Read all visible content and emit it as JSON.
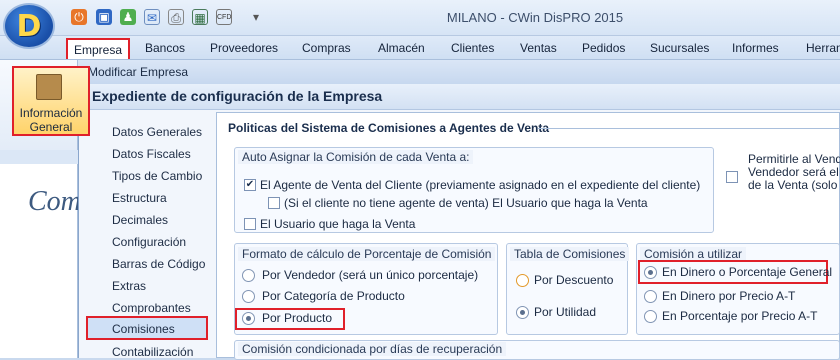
{
  "app": {
    "logo_letter": "D",
    "window_title": "MILANO - CWin DisPRO 2015",
    "quick_access_icons": [
      "power-icon",
      "save-icon",
      "users-icon",
      "mail-icon",
      "print-icon",
      "calculator-icon",
      "cfd-icon",
      "dropdown-icon"
    ]
  },
  "menu": {
    "items": [
      "Empresa",
      "Bancos",
      "Proveedores",
      "Compras",
      "Almacén",
      "Clientes",
      "Ventas",
      "Pedidos",
      "Sucursales",
      "Informes",
      "Herram"
    ]
  },
  "ribbon": {
    "info_button_label_1": "Información",
    "info_button_label_2": "General"
  },
  "left_panel": {
    "partial_text": "Com"
  },
  "modal": {
    "title": "Modificar Empresa",
    "header": "Expediente de configuración de la Empresa"
  },
  "nav": {
    "items": [
      "Datos Generales",
      "Datos Fiscales",
      "Tipos de Cambio",
      "Estructura",
      "Decimales",
      "Configuración",
      "Barras de Código",
      "Extras",
      "Comprobantes",
      "Comisiones",
      "Contabilización"
    ]
  },
  "content": {
    "section_title": "Politicas del Sistema de Comisiones a Agentes de Venta",
    "auto_assign": {
      "title": "Auto Asignar la Comisión de  cada Venta a:",
      "option1": "El Agente de Venta del Cliente (previamente asignado en el expediente del cliente)",
      "option1_sub": "(Si el cliente no tiene agente de venta) El Usuario que haga la Venta",
      "option2": "El Usuario que haga la Venta"
    },
    "permit": {
      "line1": "Permitirle al Vended",
      "line2": "Vendedor será el c",
      "line3": "de la Venta (solo e"
    },
    "formato": {
      "title": "Formato de cálculo de Porcentaje de Comisión",
      "options": [
        "Por Vendedor (será un único porcentaje)",
        "Por Categoría de Producto",
        "Por Producto"
      ]
    },
    "tabla": {
      "title": "Tabla de Comisiones",
      "options": [
        "Por Descuento",
        "Por Utilidad"
      ]
    },
    "comision": {
      "title": "Comisión a utilizar",
      "options": [
        "En Dinero o Porcentaje General",
        "En Dinero por Precio A-T",
        "En Porcentaje por Precio A-T"
      ]
    },
    "condicionada_title": "Comisión condicionada por días de recuperación"
  },
  "colors": {
    "highlight": "#e0202a",
    "accent": "#1a4fa8"
  }
}
